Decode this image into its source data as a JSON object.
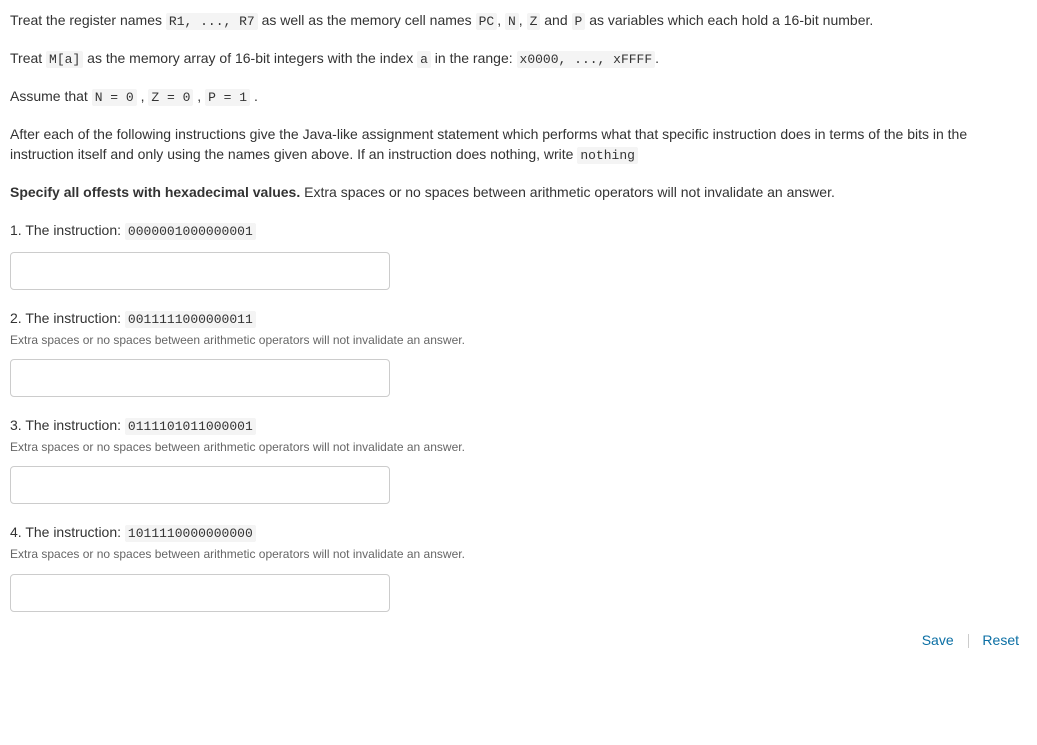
{
  "intro": {
    "p1_parts": [
      {
        "t": "Treat the register names "
      },
      {
        "c": "R1, ..., R7"
      },
      {
        "t": " as well as the memory cell names "
      },
      {
        "c": "PC"
      },
      {
        "t": ", "
      },
      {
        "c": "N"
      },
      {
        "t": ", "
      },
      {
        "c": "Z"
      },
      {
        "t": " and "
      },
      {
        "c": "P"
      },
      {
        "t": " as variables which each hold a 16-bit number."
      }
    ],
    "p2_parts": [
      {
        "t": "Treat "
      },
      {
        "c": "M[a]"
      },
      {
        "t": " as the memory array of 16-bit integers with the index "
      },
      {
        "c": "a"
      },
      {
        "t": " in the range: "
      },
      {
        "c": "x0000, ..., xFFFF"
      },
      {
        "t": "."
      }
    ],
    "p3_parts": [
      {
        "t": "Assume that "
      },
      {
        "c": "N = 0"
      },
      {
        "t": " , "
      },
      {
        "c": "Z = 0"
      },
      {
        "t": " , "
      },
      {
        "c": "P = 1"
      },
      {
        "t": " ."
      }
    ],
    "p4_parts": [
      {
        "t": "After each of the following instructions give the Java-like assignment statement which performs what that specific instruction does in terms of the bits in the instruction itself and only using the names given above. If an instruction does nothing, write "
      },
      {
        "c": "nothing"
      }
    ],
    "p5_bold": "Specify all offests with hexadecimal values.",
    "p5_rest": " Extra spaces or no spaces between arithmetic operators will not invalidate an answer."
  },
  "hint_text": "Extra spaces or no spaces between arithmetic operators will not invalidate an answer.",
  "questions": [
    {
      "num": "1",
      "label": "The instruction:",
      "code": "0000001000000001",
      "show_hint": false
    },
    {
      "num": "2",
      "label": "The instruction:",
      "code": "0011111000000011",
      "show_hint": true
    },
    {
      "num": "3",
      "label": "The instruction:",
      "code": "0111101011000001",
      "show_hint": true
    },
    {
      "num": "4",
      "label": "The instruction:",
      "code": "1011110000000000",
      "show_hint": true
    }
  ],
  "actions": {
    "save": "Save",
    "reset": "Reset"
  }
}
